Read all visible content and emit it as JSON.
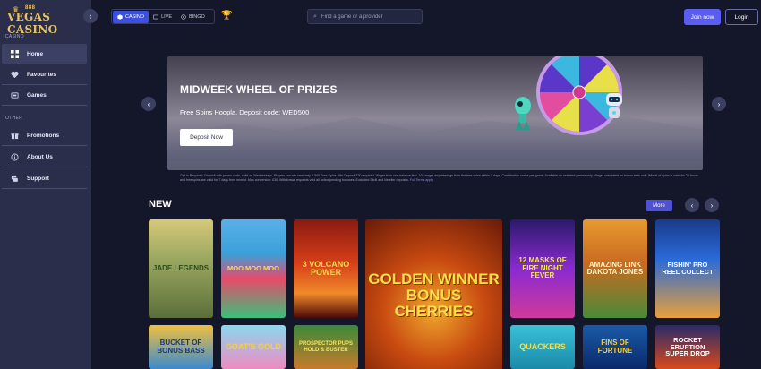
{
  "logo": {
    "top": "888",
    "main": "VEGAS CASINO"
  },
  "sidebar": {
    "sections": [
      "CASINO",
      "OTHER"
    ],
    "items": [
      {
        "label": "Home",
        "icon": "grid-icon"
      },
      {
        "label": "Favourites",
        "icon": "heart-icon"
      },
      {
        "label": "Games",
        "icon": "games-icon"
      },
      {
        "label": "Promotions",
        "icon": "gift-icon"
      },
      {
        "label": "About Us",
        "icon": "info-icon"
      },
      {
        "label": "Support",
        "icon": "support-icon"
      }
    ]
  },
  "topbar": {
    "tabs": [
      {
        "label": "CASINO",
        "icon": "cube-icon"
      },
      {
        "label": "LIVE",
        "icon": "live-icon"
      },
      {
        "label": "BINGO",
        "icon": "bingo-icon"
      }
    ],
    "search_placeholder": "Find a game or a provider",
    "join_label": "Join now",
    "login_label": "Login"
  },
  "banner": {
    "title": "MIDWEEK WHEEL OF PRIZES",
    "subtitle": "Free Spins Hoopla. Deposit code: WED500",
    "cta": "Deposit Now",
    "disclaimer": "Opt-in Required. Deposit with promo code, valid on Wednesdays. Players can win randomly 5-500 Free Spins. Min Deposit £30 required. Wager from real balance first. 10x wager any winnings from the free spins within 7 days. Contribution varies per game. Available on selected games only. Wager calculated on bonus bets only. Wheel of spins is valid for 24 hours and free spins are valid for 7 days from receipt. Max conversion: £30. Withdrawal requests void all active/pending bonuses. Excluded Skrill and Neteller deposits.",
    "disclaimer_link": "Full Terms apply"
  },
  "new_section": {
    "title": "NEW",
    "more_label": "More",
    "games": [
      {
        "title": "JADE LEGENDS"
      },
      {
        "title": "MOO MOO MOO"
      },
      {
        "title": "3 VOLCANO POWER"
      },
      {
        "title": "GOLDEN WINNER BONUS CHERRIES"
      },
      {
        "title": "12 MASKS OF FIRE NIGHT FEVER"
      },
      {
        "title": "AMAZING LINK DAKOTA JONES"
      },
      {
        "title": "FISHIN' PRO REEL COLLECT"
      },
      {
        "title": "BUCKET OF BONUS BASS"
      },
      {
        "title": "GOAT'S GOLD"
      },
      {
        "title": "PROSPECTOR PUPS HOLD & BUSTER"
      },
      {
        "title": "QUACKERS"
      },
      {
        "title": "FINS OF FORTUNE"
      },
      {
        "title": "ROCKET ERUPTION SUPER DROP"
      }
    ]
  },
  "colors": {
    "accent": "#5b5df0",
    "sidebar": "#2a2e4a",
    "background": "#14162a"
  }
}
